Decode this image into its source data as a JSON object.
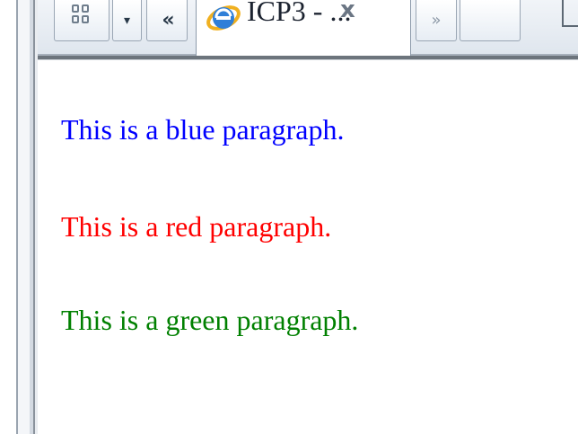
{
  "browser": {
    "tabs": {
      "active_title": "ICP3 - ...",
      "close_glyph": "x",
      "scroll_left_glyph": "«",
      "scroll_right_glyph": "»",
      "tab_list_glyph": "▾"
    },
    "icons": {
      "quick_tabs": "quick-tabs-icon",
      "favicon": "ie-favicon-icon",
      "page_menu": "page-icon"
    }
  },
  "page": {
    "paragraphs": [
      {
        "text": "This is a blue paragraph.",
        "color": "#0000ff"
      },
      {
        "text": "This is a red paragraph.",
        "color": "#ff0000"
      },
      {
        "text": "This is a green paragraph.",
        "color": "#008000"
      }
    ]
  }
}
